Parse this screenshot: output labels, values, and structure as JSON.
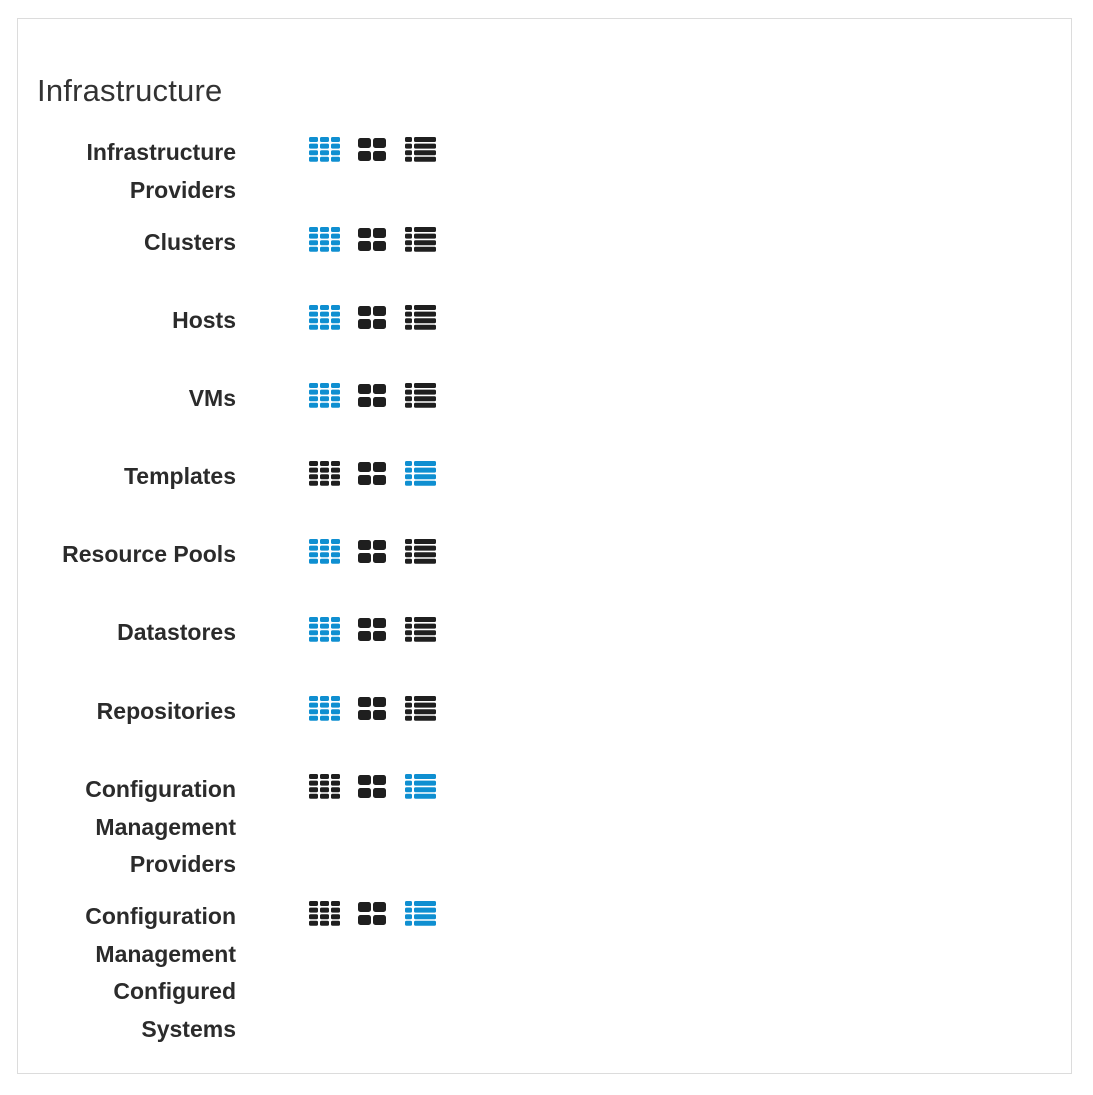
{
  "section": {
    "title": "Infrastructure"
  },
  "colors": {
    "active": "#0f8fd1",
    "inactive": "#1f1f1f",
    "border": "#dcdcdc"
  },
  "icons": {
    "grid": "grid-view-icon",
    "tile": "tile-view-icon",
    "list": "list-view-icon"
  },
  "rows": [
    {
      "label": "Infrastructure Providers",
      "selected_view": "grid"
    },
    {
      "label": "Clusters",
      "selected_view": "grid"
    },
    {
      "label": "Hosts",
      "selected_view": "grid"
    },
    {
      "label": "VMs",
      "selected_view": "grid"
    },
    {
      "label": "Templates",
      "selected_view": "list"
    },
    {
      "label": "Resource Pools",
      "selected_view": "grid"
    },
    {
      "label": "Datastores",
      "selected_view": "grid"
    },
    {
      "label": "Repositories",
      "selected_view": "grid"
    },
    {
      "label": "Configuration Management Providers",
      "selected_view": "list"
    },
    {
      "label": "Configuration Management Configured Systems",
      "selected_view": "list"
    }
  ]
}
